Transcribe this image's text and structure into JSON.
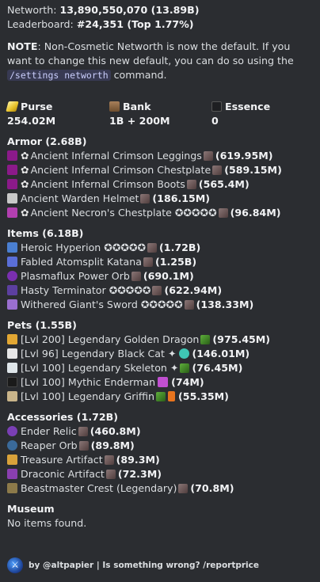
{
  "header": {
    "networth_label": "Networth:",
    "networth_value": "13,890,550,070 (13.89B)",
    "leaderboard_label": "Leaderboard:",
    "leaderboard_value": "#24,351 (Top 1.77%)"
  },
  "note": {
    "label": "NOTE",
    "text1": ": Non-Cosmetic Networth is now the default. If you want to change this new default, you can do so using the ",
    "command": "/settings networth",
    "text2": " command."
  },
  "stats": {
    "purse_label": "Purse",
    "purse_value": "254.02M",
    "bank_label": "Bank",
    "bank_value": "1B + 200M",
    "essence_label": "Essence",
    "essence_value": "0"
  },
  "armor": {
    "title": "Armor (2.68B)",
    "items": [
      {
        "name": "Ancient Infernal Crimson Leggings",
        "value": "(619.95M)",
        "color": "#8b1a8a"
      },
      {
        "name": "Ancient Infernal Crimson Chestplate",
        "value": "(589.15M)",
        "color": "#8b1a8a"
      },
      {
        "name": "Ancient Infernal Crimson Boots",
        "value": "(565.4M)",
        "color": "#8b1a8a"
      },
      {
        "name": "Ancient Warden Helmet",
        "value": "(186.15M)",
        "color": "#c8c8c8"
      },
      {
        "name": "Ancient Necron's Chestplate ✪✪✪✪✪",
        "value": "(96.84M)",
        "color": "#b23fb0"
      }
    ]
  },
  "items": {
    "title": "Items (6.18B)",
    "items": [
      {
        "name": "Heroic Hyperion ✪✪✪✪✪",
        "value": "(1.72B)",
        "color": "#4a7fd1"
      },
      {
        "name": "Fabled Atomsplit Katana",
        "value": "(1.25B)",
        "color": "#5a6fd8"
      },
      {
        "name": "Plasmaflux Power Orb",
        "value": "(690.1M)",
        "color": "#7a2fb0"
      },
      {
        "name": "Hasty Terminator ✪✪✪✪✪",
        "value": "(622.94M)",
        "color": "#5c3fa0"
      },
      {
        "name": "Withered Giant's Sword ✪✪✪✪✪",
        "value": "(138.33M)",
        "color": "#9a6fd0"
      }
    ]
  },
  "pets": {
    "title": "Pets (1.55B)",
    "items": [
      {
        "name": "[Lvl 200] Legendary Golden Dragon",
        "value": "(975.45M)",
        "color": "#e2a733"
      },
      {
        "name": "[Lvl 96] Legendary Black Cat ✦",
        "value": "(146.01M)",
        "color": "#e6e6e6"
      },
      {
        "name": "[Lvl 100] Legendary Skeleton ✦",
        "value": "(76.45M)",
        "color": "#dfe6ea"
      },
      {
        "name": "[Lvl 100] Mythic Enderman",
        "value": "(74M)",
        "color": "#1a1a1a"
      },
      {
        "name": "[Lvl 100] Legendary Griffin",
        "value": "(55.35M)",
        "color": "#c9b48a"
      }
    ]
  },
  "accessories": {
    "title": "Accessories (1.72B)",
    "items": [
      {
        "name": "Ender Relic",
        "value": "(460.8M)",
        "color": "#7a3fb5"
      },
      {
        "name": "Reaper Orb",
        "value": "(89.8M)",
        "color": "#3a6a9a"
      },
      {
        "name": "Treasure Artifact",
        "value": "(89.3M)",
        "color": "#d9a23a"
      },
      {
        "name": "Draconic Artifact",
        "value": "(72.3M)",
        "color": "#8a3fb0"
      },
      {
        "name": "Beastmaster Crest (Legendary)",
        "value": "(70.8M)",
        "color": "#8c7a4a"
      }
    ]
  },
  "museum": {
    "title": "Museum",
    "text": "No items found."
  },
  "footer": {
    "text": "by @altpapier | Is something wrong? /reportprice"
  }
}
